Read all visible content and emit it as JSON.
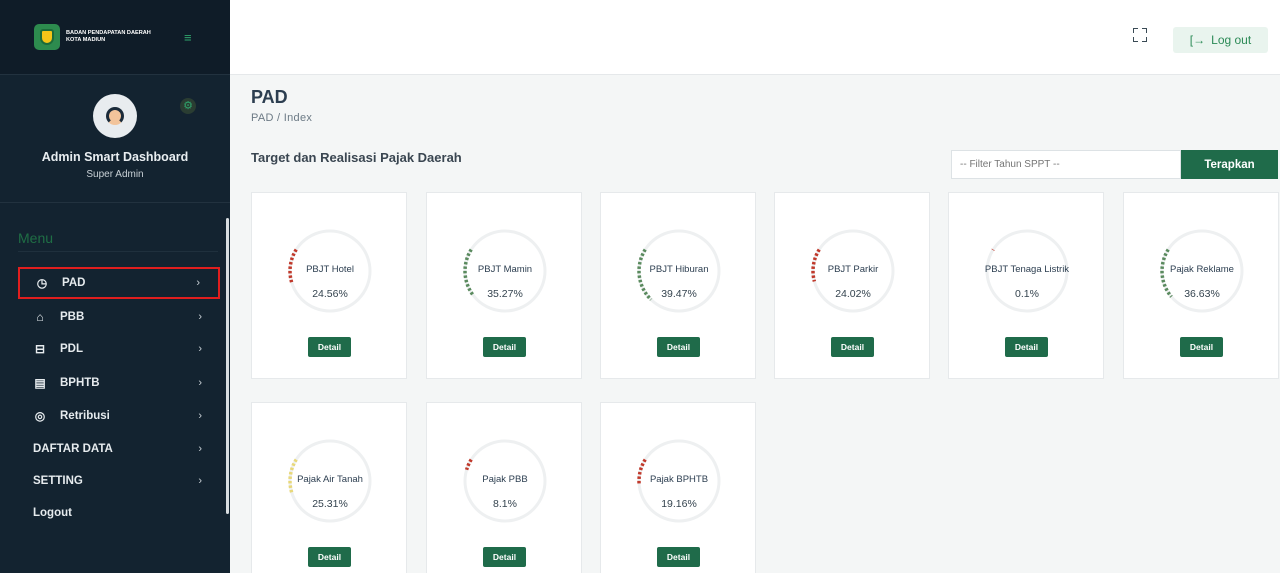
{
  "brand": {
    "line1": "BADAN PENDAPATAN DAERAH",
    "line2": "KOTA MADIUN",
    "logo_icon": "city-emblem-icon",
    "toggle_icon": "menu-toggle-icon"
  },
  "profile": {
    "name": "Admin Smart Dashboard",
    "role": "Super Admin"
  },
  "sidebar": {
    "menu_title": "Menu",
    "items": [
      {
        "label": "PAD",
        "icon": "clock-icon"
      },
      {
        "label": "PBB",
        "icon": "home-icon"
      },
      {
        "label": "PDL",
        "icon": "box-icon"
      },
      {
        "label": "BPHTB",
        "icon": "document-icon"
      },
      {
        "label": "Retribusi",
        "icon": "eye-icon"
      },
      {
        "label": "DAFTAR DATA"
      },
      {
        "label": "SETTING"
      },
      {
        "label": "Logout"
      }
    ]
  },
  "topbar": {
    "logout_label": "Log out",
    "logout_icon": "logout-arrow-icon",
    "fullscreen_icon": "fullscreen-icon"
  },
  "page": {
    "title": "PAD",
    "breadcrumb": "PAD / Index",
    "section_title": "Target dan Realisasi Pajak Daerah"
  },
  "filter": {
    "placeholder": "-- Filter Tahun SPPT --",
    "apply_label": "Terapkan"
  },
  "colors": {
    "accent": "#1f6b4a",
    "low": "#c0392b",
    "mid": "#5a8a5e",
    "yellow": "#e8d87a",
    "track": "#eef0f1"
  },
  "cards": [
    {
      "label": "PBJT Hotel",
      "value": "24.56%",
      "percent": 24.56,
      "color": "#c0392b"
    },
    {
      "label": "PBJT Mamin",
      "value": "35.27%",
      "percent": 35.27,
      "color": "#5a8a5e"
    },
    {
      "label": "PBJT Hiburan",
      "value": "39.47%",
      "percent": 39.47,
      "color": "#5a8a5e"
    },
    {
      "label": "PBJT Parkir",
      "value": "24.02%",
      "percent": 24.02,
      "color": "#c0392b"
    },
    {
      "label": "PBJT Tenaga Listrik",
      "value": "0.1%",
      "percent": 0.1,
      "color": "#c0392b"
    },
    {
      "label": "Pajak Reklame",
      "value": "36.63%",
      "percent": 36.63,
      "color": "#5a8a5e"
    },
    {
      "label": "Pajak Air Tanah",
      "value": "25.31%",
      "percent": 25.31,
      "color": "#e8d87a"
    },
    {
      "label": "Pajak PBB",
      "value": "8.1%",
      "percent": 8.1,
      "color": "#c0392b"
    },
    {
      "label": "Pajak BPHTB",
      "value": "19.16%",
      "percent": 19.16,
      "color": "#c0392b"
    }
  ],
  "detail_label": "Detail"
}
